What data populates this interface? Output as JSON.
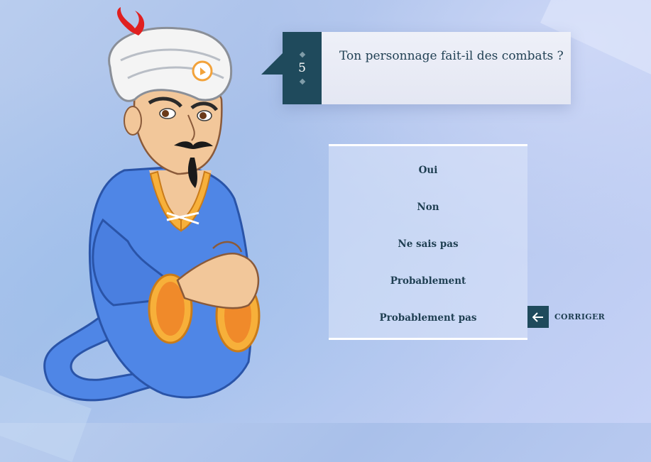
{
  "question": {
    "number": "5",
    "text": "Ton personnage fait-il des combats ?"
  },
  "answers": [
    "Oui",
    "Non",
    "Ne sais pas",
    "Probablement",
    "Probablement pas"
  ],
  "corriger": {
    "label": "CORRIGER",
    "icon": "arrow-left-icon"
  },
  "colors": {
    "accent": "#1f4a5c",
    "text": "#1f3f52",
    "robe": "#4f86e6"
  }
}
